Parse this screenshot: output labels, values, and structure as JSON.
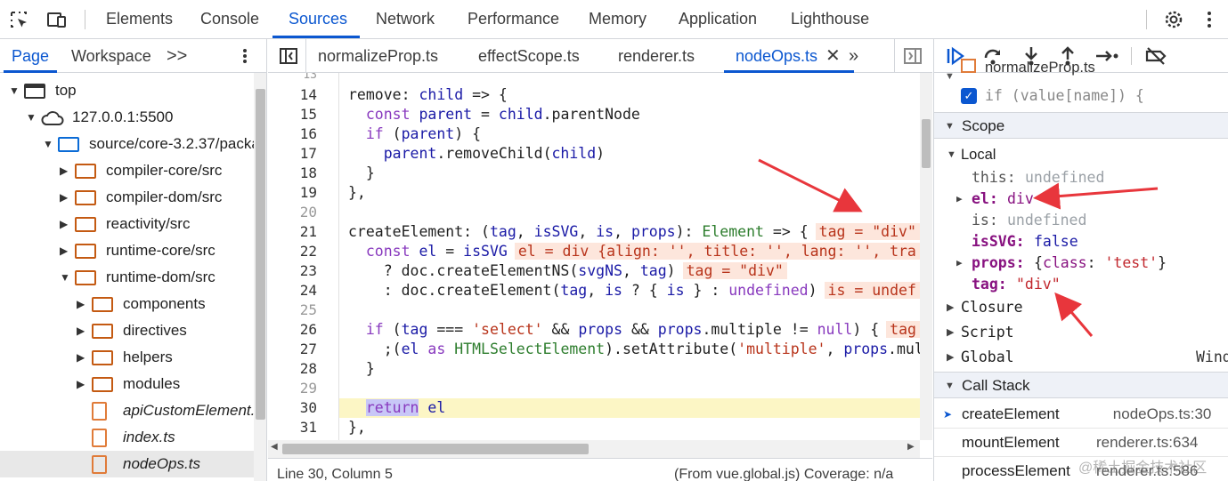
{
  "toolbar": {
    "tabs": [
      "Elements",
      "Console",
      "Sources",
      "Network",
      "Performance",
      "Memory",
      "Application",
      "Lighthouse"
    ],
    "active_tab": "Sources",
    "icons": [
      "inspect-icon",
      "device-toolbar-icon",
      "settings-icon",
      "more-vert-icon"
    ]
  },
  "navigator": {
    "tabs": [
      "Page",
      "Workspace",
      ">>"
    ],
    "tree": [
      {
        "label": "top",
        "depth": 0,
        "icon": "frame-icon",
        "expanded": true
      },
      {
        "label": "127.0.0.1:5500",
        "depth": 1,
        "icon": "cloud-icon",
        "expanded": true
      },
      {
        "label": "source/core-3.2.37/packages",
        "depth": 2,
        "icon": "folder-blue-icon",
        "expanded": true
      },
      {
        "label": "compiler-core/src",
        "depth": 3,
        "icon": "folder-icon",
        "expanded": false
      },
      {
        "label": "compiler-dom/src",
        "depth": 3,
        "icon": "folder-icon",
        "expanded": false
      },
      {
        "label": "reactivity/src",
        "depth": 3,
        "icon": "folder-icon",
        "expanded": false
      },
      {
        "label": "runtime-core/src",
        "depth": 3,
        "icon": "folder-icon",
        "expanded": false
      },
      {
        "label": "runtime-dom/src",
        "depth": 3,
        "icon": "folder-icon",
        "expanded": true
      },
      {
        "label": "components",
        "depth": 4,
        "icon": "folder-icon",
        "expanded": false
      },
      {
        "label": "directives",
        "depth": 4,
        "icon": "folder-icon",
        "expanded": false
      },
      {
        "label": "helpers",
        "depth": 4,
        "icon": "folder-icon",
        "expanded": false
      },
      {
        "label": "modules",
        "depth": 4,
        "icon": "folder-icon",
        "expanded": false
      },
      {
        "label": "apiCustomElement.ts",
        "depth": 4,
        "icon": "file-icon"
      },
      {
        "label": "index.ts",
        "depth": 4,
        "icon": "file-icon"
      },
      {
        "label": "nodeOps.ts",
        "depth": 4,
        "icon": "file-icon",
        "selected": true
      }
    ]
  },
  "editor": {
    "tabs": [
      "normalizeProp.ts",
      "effectScope.ts",
      "renderer.ts",
      "nodeOps.ts"
    ],
    "active_tab": "nodeOps.ts",
    "lines": [
      {
        "n": "13",
        "text": ""
      },
      {
        "n": "14",
        "text": "remove: child => {"
      },
      {
        "n": "15",
        "text": "  const parent = child.parentNode"
      },
      {
        "n": "16",
        "text": "  if (parent) {"
      },
      {
        "n": "17",
        "text": "    parent.removeChild(child)"
      },
      {
        "n": "18",
        "text": "  }"
      },
      {
        "n": "19",
        "text": "},"
      },
      {
        "n": "20",
        "text": ""
      },
      {
        "n": "21",
        "text": "createElement: (tag, isSVG, is, props): Element => {",
        "inline": "tag = \"div\""
      },
      {
        "n": "22",
        "text": "  const el = isSVG",
        "inline": "el = div {align: '', title: '', lang: '', tra"
      },
      {
        "n": "23",
        "text": "    ? doc.createElementNS(svgNS, tag)",
        "inline": "tag = \"div\""
      },
      {
        "n": "24",
        "text": "    : doc.createElement(tag, is ? { is } : undefined)",
        "inline": "is = undef"
      },
      {
        "n": "25",
        "text": ""
      },
      {
        "n": "26",
        "text": "  if (tag === 'select' && props && props.multiple != null) {",
        "inline": "tag"
      },
      {
        "n": "27",
        "text": "    ;(el as HTMLSelectElement).setAttribute('multiple', props.mul"
      },
      {
        "n": "28",
        "text": "  }"
      },
      {
        "n": "29",
        "text": ""
      },
      {
        "n": "30",
        "text": "  return el",
        "highlight": true
      },
      {
        "n": "31",
        "text": "},"
      }
    ],
    "status_left": "Line 30, Column 5",
    "status_right": "(From vue.global.js) Coverage: n/a"
  },
  "debugger": {
    "breakpoint_file": "normalizeProp.ts",
    "breakpoint_code": "if (value[name]) {",
    "scope_title": "Scope",
    "local_title": "Local",
    "locals": [
      {
        "name": "this",
        "value": "undefined",
        "kind": "undef"
      },
      {
        "name": "el",
        "value": "div",
        "kind": "obj",
        "expandable": true
      },
      {
        "name": "is",
        "value": "undefined",
        "kind": "undef"
      },
      {
        "name": "isSVG",
        "value": "false",
        "kind": "num"
      },
      {
        "name": "props",
        "value": "{class: 'test'}",
        "kind": "obj",
        "expandable": true
      },
      {
        "name": "tag",
        "value": "\"div\"",
        "kind": "str"
      }
    ],
    "other_scopes": [
      {
        "label": "Closure",
        "extra": ""
      },
      {
        "label": "Script",
        "extra": ""
      },
      {
        "label": "Global",
        "extra": "Wind"
      }
    ],
    "callstack_title": "Call Stack",
    "callstack": [
      {
        "fn": "createElement",
        "loc": "nodeOps.ts:30",
        "current": true
      },
      {
        "fn": "mountElement",
        "loc": "renderer.ts:634"
      },
      {
        "fn": "processElement",
        "loc": "renderer.ts:586"
      }
    ],
    "watermark": "@稀土掘金技术社区"
  },
  "colors": {
    "accent": "#0b57d0",
    "annotation_arrow": "#e8363c",
    "exec_line": "#fcf6c5"
  }
}
